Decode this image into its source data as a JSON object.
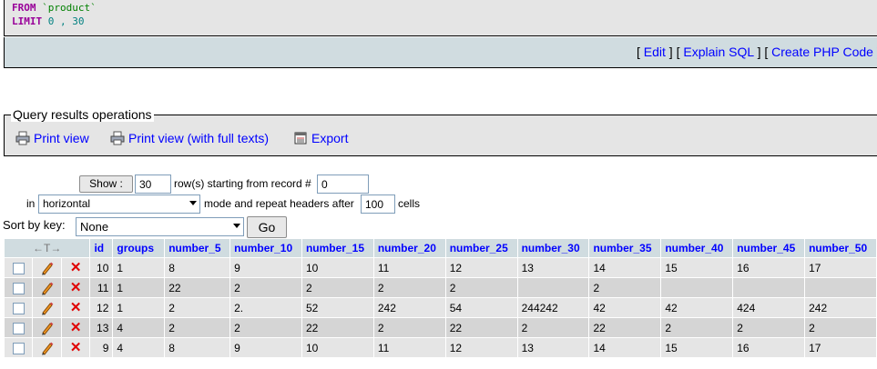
{
  "sql": {
    "from_kw": "FROM",
    "from_table": "`product`",
    "limit_kw": "LIMIT",
    "limit_value": "0 , 30"
  },
  "links": {
    "open1": "[",
    "edit": "Edit",
    "sep1": "] [",
    "explain": "Explain SQL",
    "sep2": "] [",
    "create_php": "Create PHP Code",
    "close": "]"
  },
  "operations": {
    "legend": "Query results operations",
    "print_view": "Print view",
    "print_view_full": "Print view (with full texts)",
    "export": "Export",
    "icons": [
      "printer-icon",
      "printer-icon",
      "export-icon"
    ]
  },
  "nav": {
    "show_label": "Show :",
    "rows_value": "30",
    "rows_text": "row(s) starting from record #",
    "start_value": "0",
    "in_text": "in",
    "mode_value": "horizontal",
    "mode_text": "mode and repeat headers after",
    "repeat_value": "100",
    "cells_text": "cells"
  },
  "sort": {
    "label": "Sort by key:",
    "value": "None",
    "go_label": "Go"
  },
  "table": {
    "arrows": "←T→",
    "columns": [
      "id",
      "groups",
      "number_5",
      "number_10",
      "number_15",
      "number_20",
      "number_25",
      "number_30",
      "number_35",
      "number_40",
      "number_45",
      "number_50"
    ],
    "rows": [
      [
        "10",
        "1",
        "8",
        "9",
        "10",
        "11",
        "12",
        "13",
        "14",
        "15",
        "16",
        "17"
      ],
      [
        "11",
        "1",
        "22",
        "2",
        "2",
        "2",
        "2",
        "",
        "2",
        "",
        "",
        ""
      ],
      [
        "12",
        "1",
        "2",
        "2.",
        "52",
        "242",
        "54",
        "244242",
        "42",
        "42",
        "424",
        "242"
      ],
      [
        "13",
        "4",
        "2",
        "2",
        "22",
        "2",
        "22",
        "2",
        "22",
        "2",
        "2",
        "2"
      ],
      [
        "9",
        "4",
        "8",
        "9",
        "10",
        "11",
        "12",
        "13",
        "14",
        "15",
        "16",
        "17"
      ]
    ]
  }
}
